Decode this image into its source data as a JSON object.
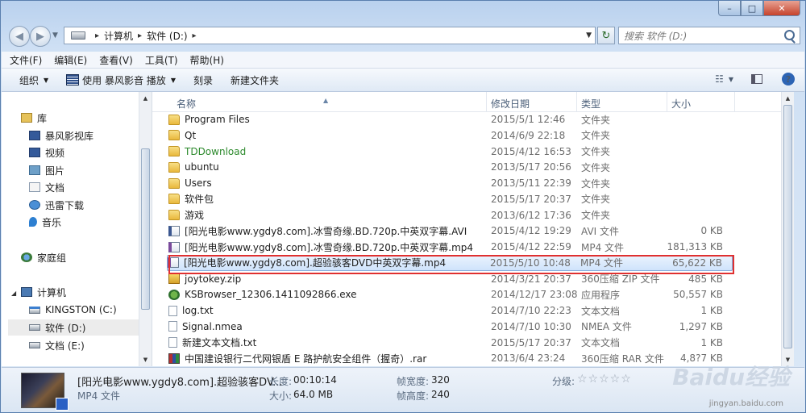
{
  "window": {
    "caption": {
      "minimize": "–",
      "maximize": "□",
      "close": "✕"
    }
  },
  "address": {
    "path": [
      "计算机",
      "软件 (D:)"
    ],
    "search_placeholder": "搜索 软件 (D:)"
  },
  "menu": [
    "文件(F)",
    "编辑(E)",
    "查看(V)",
    "工具(T)",
    "帮助(H)"
  ],
  "toolbar": {
    "organize": "组织",
    "play_with": "使用 暴风影音 播放",
    "burn": "刻录",
    "new_folder": "新建文件夹"
  },
  "nav": {
    "libraries": "库",
    "lib_items": [
      "暴风影视库",
      "视频",
      "图片",
      "文档",
      "迅雷下载",
      "音乐"
    ],
    "homegroup": "家庭组",
    "computer": "计算机",
    "drives": [
      "KINGSTON (C:)",
      "软件 (D:)",
      "文档 (E:)"
    ]
  },
  "columns": {
    "name": "名称",
    "date": "修改日期",
    "type": "类型",
    "size": "大小"
  },
  "files": [
    {
      "name": "Program Files",
      "date": "2015/5/1 12:46",
      "type": "文件夹",
      "size": "",
      "icon": "folder"
    },
    {
      "name": "Qt",
      "date": "2014/6/9 22:18",
      "type": "文件夹",
      "size": "",
      "icon": "folder"
    },
    {
      "name": "TDDownload",
      "date": "2015/4/12 16:53",
      "type": "文件夹",
      "size": "",
      "icon": "folder",
      "color": "#2d8a2d"
    },
    {
      "name": "ubuntu",
      "date": "2013/5/17 20:56",
      "type": "文件夹",
      "size": "",
      "icon": "folder"
    },
    {
      "name": "Users",
      "date": "2013/5/11 22:39",
      "type": "文件夹",
      "size": "",
      "icon": "folder"
    },
    {
      "name": "软件包",
      "date": "2015/5/17 20:37",
      "type": "文件夹",
      "size": "",
      "icon": "folder"
    },
    {
      "name": "游戏",
      "date": "2013/6/12 17:36",
      "type": "文件夹",
      "size": "",
      "icon": "folder"
    },
    {
      "name": "[阳光电影www.ygdy8.com].冰雪奇缘.BD.720p.中英双字幕.AVI",
      "date": "2015/4/12 19:29",
      "type": "AVI 文件",
      "size": "0 KB",
      "icon": "avi"
    },
    {
      "name": "[阳光电影www.ygdy8.com].冰雪奇缘.BD.720p.中英双字幕.mp4",
      "date": "2015/4/12 22:59",
      "type": "MP4 文件",
      "size": "181,313 KB",
      "icon": "mp4"
    },
    {
      "name": "[阳光电影www.ygdy8.com].超验骇客DVD中英双字幕.mp4",
      "date": "2015/5/10 10:48",
      "type": "MP4 文件",
      "size": "65,622 KB",
      "icon": "mp4",
      "selected": true
    },
    {
      "name": "joytokey.zip",
      "date": "2014/3/21 20:37",
      "type": "360压缩 ZIP 文件",
      "size": "485 KB",
      "icon": "zip"
    },
    {
      "name": "KSBrowser_12306.1411092866.exe",
      "date": "2014/12/17 23:08",
      "type": "应用程序",
      "size": "50,557 KB",
      "icon": "exe"
    },
    {
      "name": "log.txt",
      "date": "2014/7/10 22:23",
      "type": "文本文档",
      "size": "1 KB",
      "icon": "txt"
    },
    {
      "name": "Signal.nmea",
      "date": "2014/7/10 10:30",
      "type": "NMEA 文件",
      "size": "1,297 KB",
      "icon": "txt"
    },
    {
      "name": "新建文本文档.txt",
      "date": "2015/5/17 20:37",
      "type": "文本文档",
      "size": "1 KB",
      "icon": "txt"
    },
    {
      "name": "中国建设银行二代网银盾 E 路护航安全组件（握奇）.rar",
      "date": "2013/6/4 23:24",
      "type": "360压缩 RAR 文件",
      "size": "4,8?7 KB",
      "icon": "rar"
    }
  ],
  "details": {
    "name": "[阳光电影www.ygdy8.com].超验骇客DV...",
    "type": "MP4 文件",
    "length_label": "长度:",
    "length": "00:10:14",
    "size_label": "大小:",
    "size": "64.0 MB",
    "width_label": "帧宽度:",
    "width": "320",
    "height_label": "帧高度:",
    "height": "240",
    "rating_label": "分级:",
    "rating_stars": "☆☆☆☆☆"
  },
  "watermark": {
    "text": "Baidu经验",
    "url": "jingyan.baidu.com"
  }
}
